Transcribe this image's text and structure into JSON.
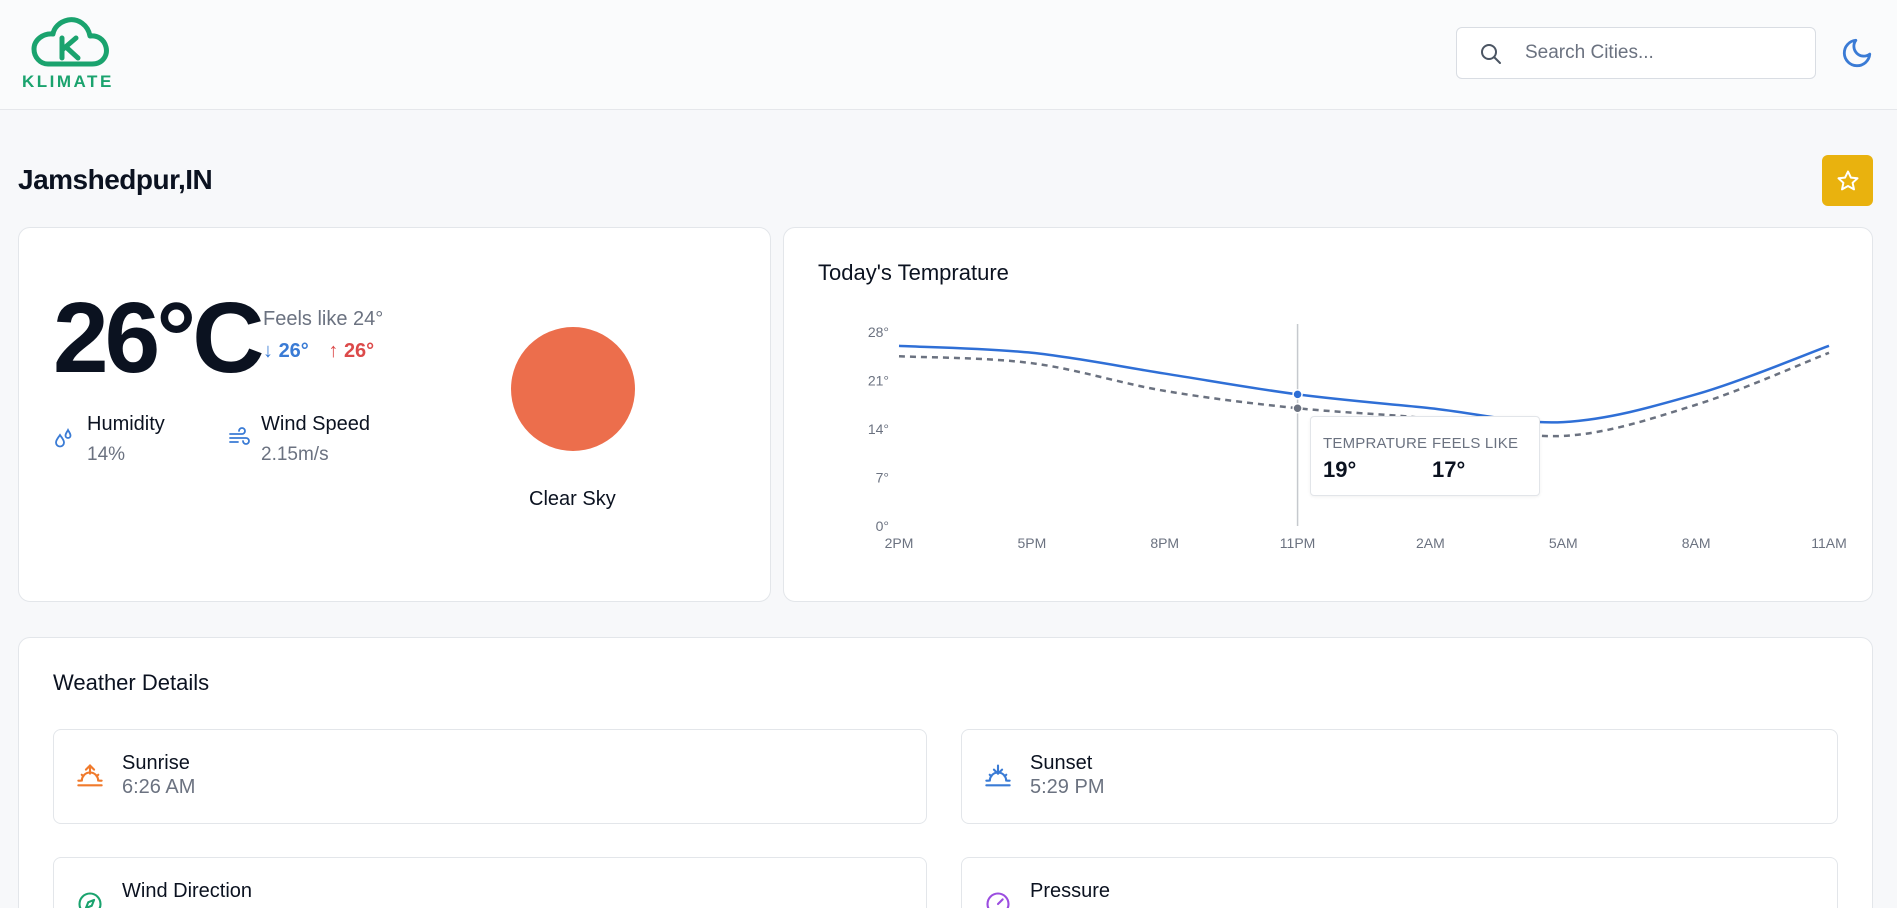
{
  "brand": {
    "name": "KLIMATE",
    "color": "#1aa36e"
  },
  "search": {
    "placeholder": "Search Cities...",
    "icon": "search-icon"
  },
  "theme_toggle": {
    "icon": "moon-icon"
  },
  "location": {
    "name": "Jamshedpur,IN"
  },
  "favorite": {
    "icon": "star-icon",
    "color": "#e9b20e"
  },
  "current": {
    "temperature": "26°C",
    "feels_like": "Feels like 24°",
    "min": "26°",
    "max": "26°",
    "humidity_label": "Humidity",
    "humidity_value": "14%",
    "wind_label": "Wind Speed",
    "wind_value": "2.15m/s",
    "description": "Clear Sky",
    "weather_icon": "sun-icon"
  },
  "hourly": {
    "title": "Today's Temprature",
    "tooltip": {
      "temp_label": "TEMPRATURE",
      "temp_value": "19°",
      "feels_label": "FEELS LIKE",
      "feels_value": "17°"
    }
  },
  "chart_data": {
    "type": "line",
    "title": "Today's Temprature",
    "x": [
      "2PM",
      "5PM",
      "8PM",
      "11PM",
      "2AM",
      "5AM",
      "8AM",
      "11AM"
    ],
    "y_ticks": [
      "0°",
      "7°",
      "14°",
      "21°",
      "28°"
    ],
    "ylim": [
      0,
      28
    ],
    "series": [
      {
        "key": "temp",
        "values": [
          26,
          25,
          22,
          19,
          17,
          15,
          19,
          26
        ],
        "color": "#2f6fd6",
        "style": "solid"
      },
      {
        "key": "feels_like",
        "values": [
          24.5,
          23.5,
          19.5,
          17,
          15.5,
          13,
          17.5,
          25
        ],
        "color": "#6b7280",
        "style": "dashed"
      }
    ],
    "highlight_x": "11PM",
    "grid": false
  },
  "details": {
    "title": "Weather Details",
    "items": [
      {
        "label": "Sunrise",
        "value": "6:26 AM",
        "icon": "sunrise-icon",
        "color": "#f07a2c"
      },
      {
        "label": "Sunset",
        "value": "5:29 PM",
        "icon": "sunset-icon",
        "color": "#3a7bd5"
      },
      {
        "label": "Wind Direction",
        "icon": "compass-icon",
        "color": "#1aa36e"
      },
      {
        "label": "Pressure",
        "icon": "gauge-icon",
        "color": "#9b4de0"
      }
    ]
  }
}
